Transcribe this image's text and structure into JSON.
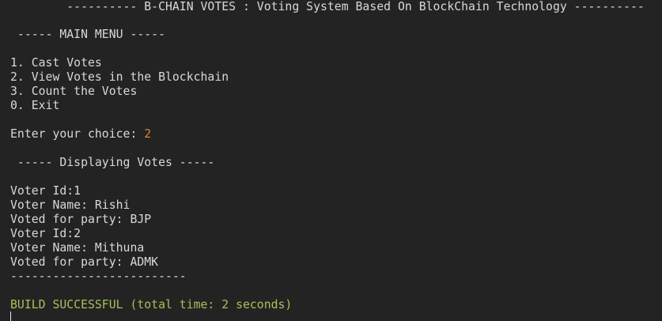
{
  "colors": {
    "background": "#232323",
    "text": "#d8d8d8",
    "input_accent": "#d8843c",
    "build_status": "#a5c25c"
  },
  "output": {
    "header": "        ---------- B-CHAIN VOTES : Voting System Based On BlockChain Technology ----------",
    "menu_title": " ----- MAIN MENU -----",
    "menu_items": [
      "1. Cast Votes",
      "2. View Votes in the Blockchain",
      "3. Count the Votes",
      "0. Exit"
    ],
    "prompt": "Enter your choice: ",
    "choice": "2",
    "display_title": " ----- Displaying Votes -----",
    "votes": [
      {
        "voter_id": "Voter Id:1",
        "voter_name": "Voter Name: Rishi",
        "party": "Voted for party: BJP"
      },
      {
        "voter_id": "Voter Id:2",
        "voter_name": "Voter Name: Mithuna",
        "party": "Voted for party: ADMK"
      }
    ],
    "separator": "-------------------------",
    "build_status": "BUILD SUCCESSFUL (total time: 2 seconds)"
  }
}
